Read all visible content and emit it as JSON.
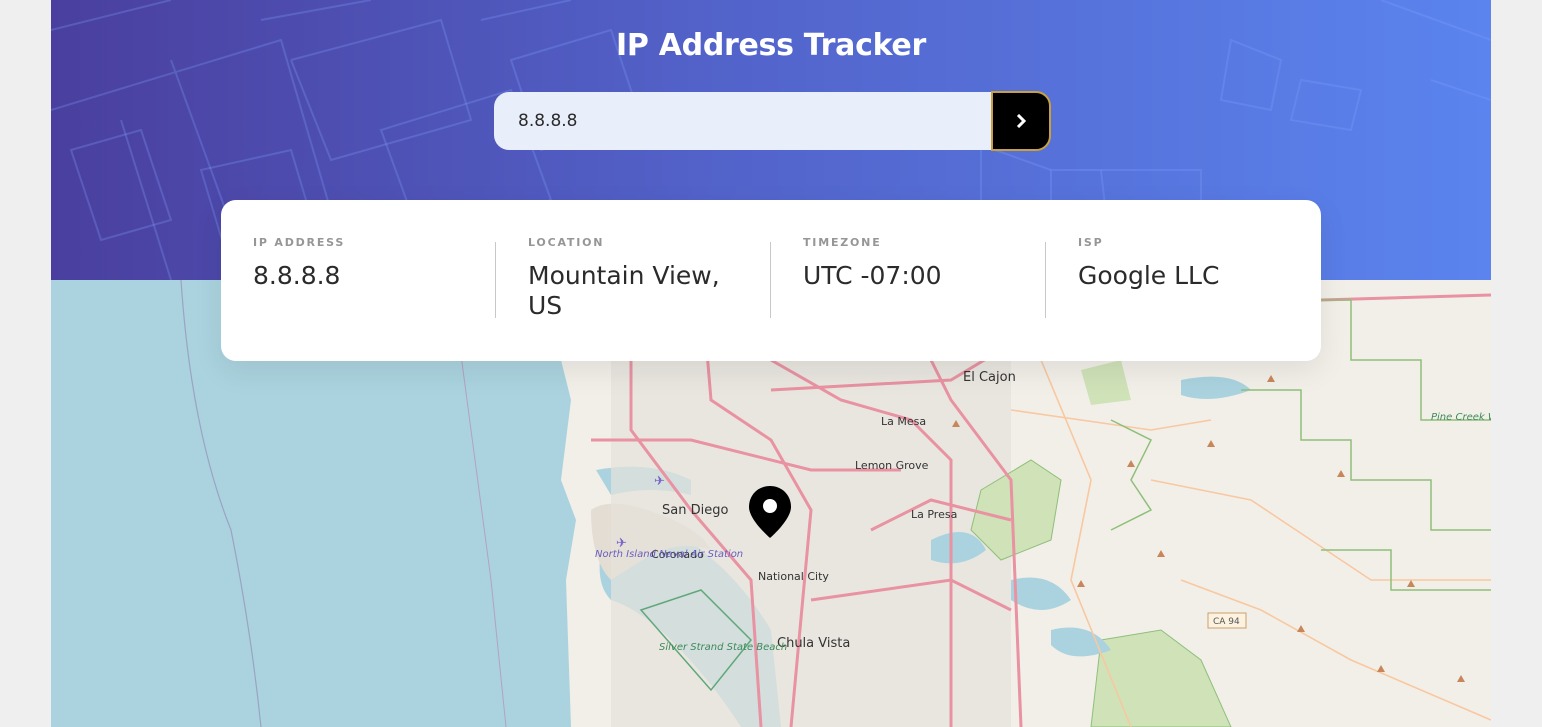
{
  "header": {
    "title": "IP Address Tracker"
  },
  "search": {
    "value": "8.8.8.8",
    "button_icon": "chevron-right-icon"
  },
  "info": [
    {
      "label": "IP ADDRESS",
      "value": "8.8.8.8"
    },
    {
      "label": "LOCATION",
      "value": "Mountain View, US"
    },
    {
      "label": "TIMEZONE",
      "value": "UTC -07:00"
    },
    {
      "label": "ISP",
      "value": "Google LLC"
    }
  ],
  "map": {
    "places": [
      "San Diego",
      "El Cajon",
      "La Mesa",
      "Lemon Grove",
      "La Presa",
      "National City",
      "Chula Vista",
      "Coronado"
    ],
    "parks": [
      "North Island Naval Air Station",
      "Silver Strand State Beach",
      "Pine Creek Wilderness"
    ],
    "road_badge": "CA 94",
    "marker_icon": "location-pin-icon"
  },
  "colors": {
    "gradient_start": "#4a3f9e",
    "gradient_end": "#5b84ee",
    "sea": "#aad3df",
    "land": "#f2efe9",
    "button": "#000000"
  }
}
